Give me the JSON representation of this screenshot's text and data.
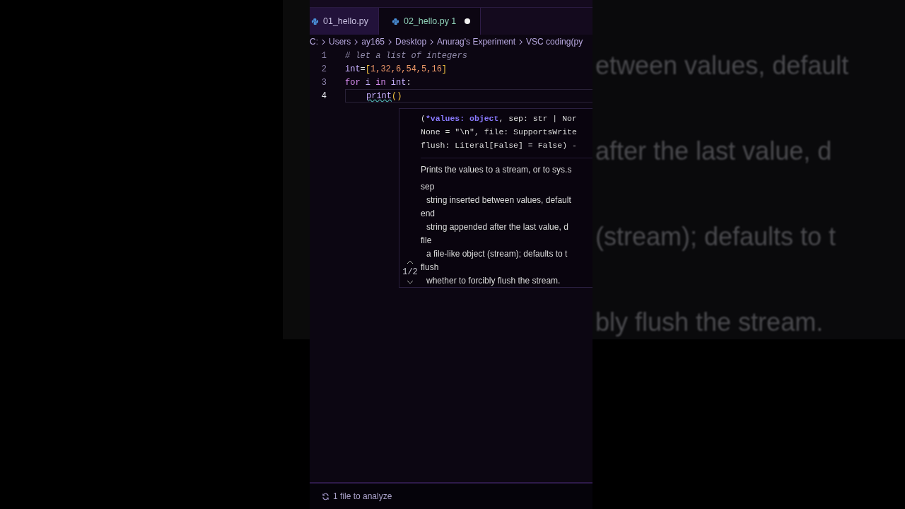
{
  "tabs": [
    {
      "label": "01_hello.py",
      "selected": false,
      "modified": false
    },
    {
      "label": "02_hello.py 1",
      "selected": true,
      "modified": true
    }
  ],
  "breadcrumb": [
    "C:",
    "Users",
    "ay165",
    "Desktop",
    "Anurag's Experiment",
    "VSC coding(py"
  ],
  "code": [
    {
      "number": "1",
      "active": false,
      "indented": false,
      "tokens": [
        {
          "text": "# let a list of integers",
          "kind": "comment"
        }
      ]
    },
    {
      "number": "2",
      "active": false,
      "indented": false,
      "tokens": [
        {
          "text": "int",
          "kind": "name"
        },
        {
          "text": "=",
          "kind": "punct"
        },
        {
          "text": "[",
          "kind": "bracket"
        },
        {
          "text": "1,32,6,54,5,16",
          "kind": "number"
        },
        {
          "text": "]",
          "kind": "bracket"
        }
      ]
    },
    {
      "number": "3",
      "active": false,
      "indented": false,
      "tokens": [
        {
          "text": "for",
          "kind": "keyword"
        },
        {
          "text": " i ",
          "kind": "name"
        },
        {
          "text": "in",
          "kind": "keyword"
        },
        {
          "text": " int",
          "kind": "name"
        },
        {
          "text": ":",
          "kind": "punct"
        }
      ]
    },
    {
      "number": "4",
      "active": true,
      "indented": true,
      "tokens": [
        {
          "text": "print",
          "kind": "error"
        },
        {
          "text": "()",
          "kind": "bracket"
        }
      ]
    }
  ],
  "signature_help": {
    "signature": [
      [
        {
          "text": "(",
          "kind": "plain"
        },
        {
          "text": "*values: object",
          "kind": "active"
        },
        {
          "text": ", sep: str | Nor",
          "kind": "plain"
        }
      ],
      [
        {
          "text": "None = \"\\n\", file: SupportsWrite",
          "kind": "plain"
        }
      ],
      [
        {
          "text": "flush: Literal[False] = False) -",
          "kind": "plain"
        }
      ]
    ],
    "description": "Prints the values to a stream, or to sys.s",
    "params": [
      {
        "name": "sep",
        "doc": "string inserted between values, default"
      },
      {
        "name": "end",
        "doc": "string appended after the last value, d"
      },
      {
        "name": "file",
        "doc": "a file-like object (stream); defaults to t"
      },
      {
        "name": "flush",
        "doc": "whether to forcibly flush the stream."
      }
    ],
    "overload": "1/2"
  },
  "status_bar": {
    "text": "1 file to analyze"
  },
  "backdrop": [
    "etween values, default",
    "after the last value, d",
    "(stream); defaults to t",
    "bly flush the stream."
  ]
}
